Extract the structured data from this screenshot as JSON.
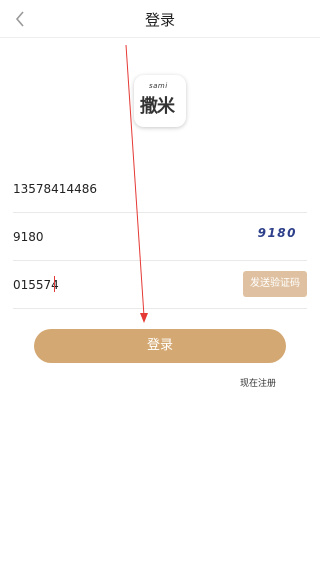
{
  "header": {
    "title": "登录",
    "back_icon": "chevron-left-icon"
  },
  "logo": {
    "subtitle": "sami",
    "text": "撒米"
  },
  "form": {
    "phone_value": "13578414486",
    "captcha_value": "9180",
    "captcha_image_text": "9180",
    "sms_code_value": "015574",
    "send_code_label": "发送验证码"
  },
  "actions": {
    "login_label": "登录",
    "register_label": "现在注册"
  },
  "colors": {
    "accent": "#d4a872",
    "send_code_bg": "#dfc1a1",
    "captcha_text": "#2d3f8a",
    "caret": "#e53935"
  }
}
